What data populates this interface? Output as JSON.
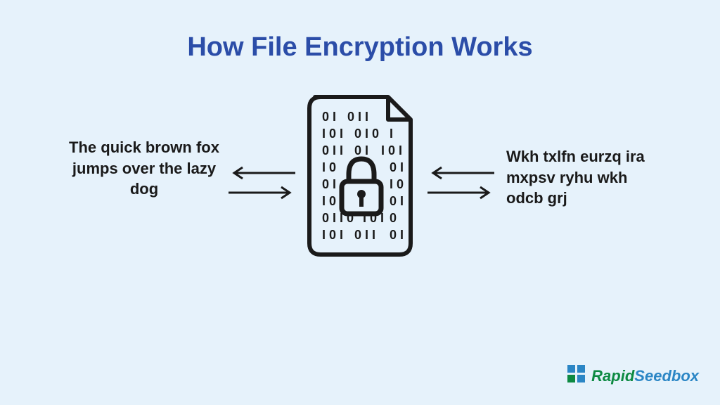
{
  "title": "How File Encryption Works",
  "plaintext": "The quick brown fox jumps over the lazy dog",
  "ciphertext": "Wkh txlfn eurzq ira mxpsv ryhu wkh odcb grj",
  "logo": {
    "rapid": "Rapid",
    "seedbox": "Seedbox"
  }
}
